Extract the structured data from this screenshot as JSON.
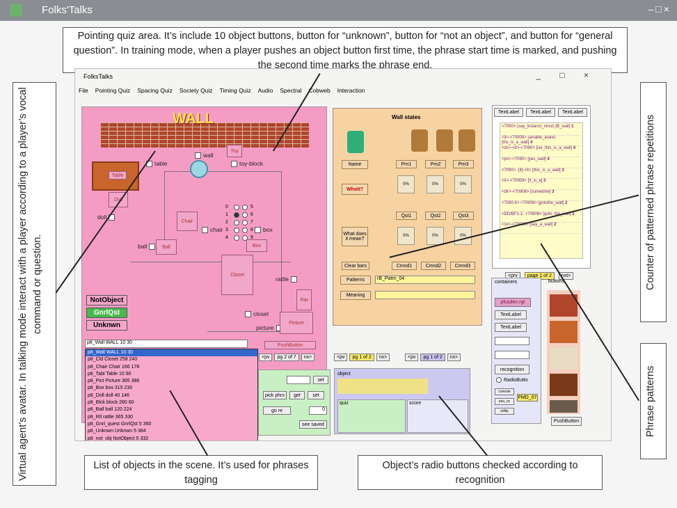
{
  "window_title": "Folks'Talks",
  "window_controls": "–□×",
  "inner_window": {
    "title": "FolksTalks",
    "controls": "_ □ ×"
  },
  "menu": [
    "File",
    "Pointing Quiz",
    "Spacing Quiz",
    "Society Quiz",
    "Timing Quiz",
    "Audio",
    "Spectral",
    "Cobweb",
    "Interaction"
  ],
  "callouts": {
    "pointing_quiz": "Pointing quiz area. It’s include 10 object buttons, button for “unknown”, button for “not an object”, and button for “general question”.  In training mode, when a player pushes an object button first time, the phrase start time is marked, and pushing the second time marks the phrase end.",
    "avatar": "Virtual agent’s avatar. In talking mode interact with a player according to a player’s vocal command or question.",
    "counter": "Counter of patterned phrase repetitions",
    "phrase_patterns": "Phrase patterns",
    "list_objects": "List of objects in the scene. It’s used for phrases tagging",
    "radio_buttons": "Object’s radio buttons checked according to recognition"
  },
  "scene": {
    "wall_label": "WALL",
    "objects": {
      "table": "table",
      "wall": "wall",
      "toy_block": "toy-block",
      "doll": "doll",
      "chair": "chair",
      "box": "box",
      "ball": "ball",
      "rattle": "rattle",
      "closet": "closet",
      "picture": "picture"
    },
    "buttons": {
      "table": "Table",
      "doll": "Doll",
      "chair": "Chair",
      "box": "Box",
      "ball": "Ball",
      "closet": "Closet",
      "toy": "Toy",
      "picture": "Picture",
      "rattle": "Rat",
      "pushbutton": "PushButton"
    },
    "radio_digits": [
      "0",
      "5",
      "1",
      "6",
      "2",
      "7",
      "3",
      "8",
      "4",
      "9"
    ],
    "side_buttons": [
      "NotObject",
      "GnrlQst",
      "Unknwn"
    ],
    "dropdown_selected": "p8_Wall WALL 10 30",
    "dropdown_items": [
      "p8_Wall WALL 10 30",
      "p8_Cld Closet 258 240",
      "p8_Chair Chair 166 178",
      "p8_Tabl Table 10 90",
      "p8_Pict Picture 365 386",
      "p8_Box box 315 230",
      "p8_Doll doll 40 146",
      "p8_Blck block 260 60",
      "p8_Ball ball 120 224",
      "p8_Rtl rattle 365 330",
      "p8_Gnrl_quest GnrlQst 5 360",
      "p8_Unknwn Unknwn 5 384",
      "p8_not_obj NotObject 5 332"
    ]
  },
  "center_panel": {
    "wall_states": "Wall states",
    "name_btn": "Name",
    "whosit": "WhoIt?",
    "what_does": "What does it mean?",
    "prn": [
      "Prn1",
      "Prn2",
      "Prn3"
    ],
    "qst": [
      "Qst1",
      "Qst2",
      "Qst3"
    ],
    "cmnd": [
      "Cmnd1",
      "Cmnd2",
      "Cmnd3"
    ],
    "pct": "0%",
    "clear_bars": "Clear bars",
    "patterns_label": "Patterns",
    "patterns_value": "rB_Patrn_04",
    "meaning_label": "Meaning"
  },
  "right_panel": {
    "textlabels": [
      "TextLabel",
      "TextLabel",
      "TextLabel"
    ],
    "phrases": [
      "<7090> (say_instanct_nmst) [B_wall]",
      "<it>-<70908> (arrable_arare) [ths_is_a_wall]",
      "<ds>-<it>-<7090> [ise_this_is_a_wall]",
      "<ps>-<7090> [yes_wall]",
      "<7090> -[it]-<it> [this_is_a_wall]",
      "<ir>-<70908> [it_is_a]",
      "<dir>-<70908> [sometime]",
      "<7090-it> <70908> [gotothe_wall]",
      "<DD/BF1-1- <70908> [goto_the_wall]",
      "<sx>-<70908> [say_a_wall]"
    ],
    "counts": [
      "1",
      "4",
      "4",
      "4",
      "3",
      "3",
      "3",
      "2",
      "2",
      "2"
    ],
    "pager": {
      "prev": "<prv",
      "label": "page 1 of 2",
      "next": "nxt>"
    },
    "containers": "containers",
    "buttons": "buttons",
    "cont_items": [
      "plusden.rgt",
      "TextLabel",
      "TextLabel"
    ],
    "recognition": "recognition",
    "radio": "RadioButto",
    "small": [
      "console",
      "pso_ov",
      "FMD_07",
      "utility"
    ],
    "pushbutton": "PushButton"
  },
  "pagers": {
    "pg_a": "pg 2 of 7",
    "pg_b": "pg 1 of 2",
    "pg_c": "pg 1 of 2",
    "prev": "<pv",
    "next": "nx>"
  },
  "lower": {
    "object_label": "object",
    "quiz_label": "quiz",
    "score_label": "score",
    "green_btns": [
      "set",
      "pick phrs",
      "get",
      "set",
      "go re",
      "see saved"
    ],
    "pct_val": "0"
  }
}
